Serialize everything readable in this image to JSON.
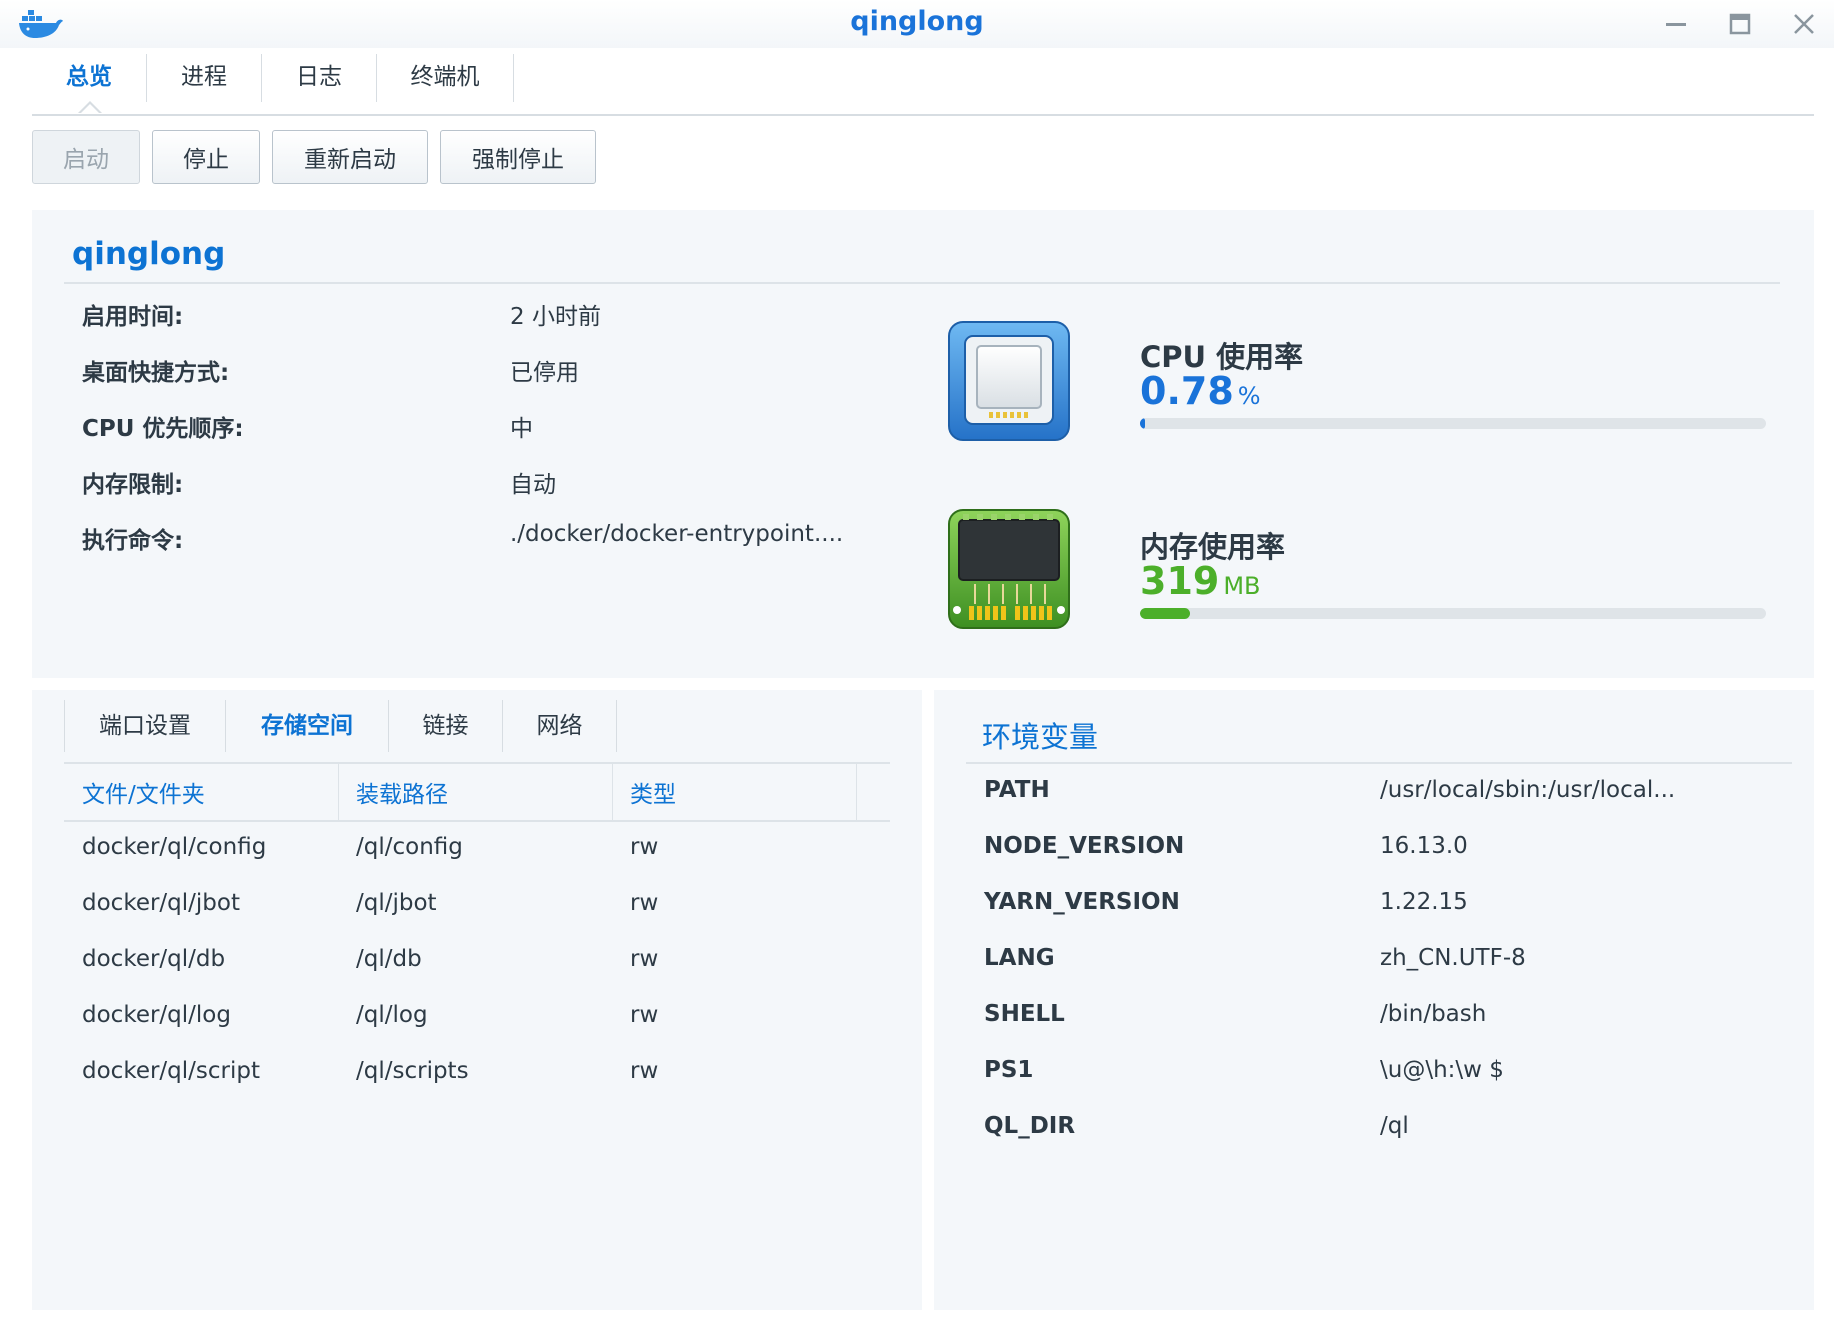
{
  "window": {
    "title": "qinglong",
    "app_icon": "docker-whale-icon"
  },
  "tabs": [
    {
      "label": "总览",
      "active": true
    },
    {
      "label": "进程",
      "active": false
    },
    {
      "label": "日志",
      "active": false
    },
    {
      "label": "终端机",
      "active": false
    }
  ],
  "toolbar": {
    "start": "启动",
    "stop": "停止",
    "restart": "重新启动",
    "force_stop": "强制停止"
  },
  "container": {
    "name": "qinglong",
    "info": [
      {
        "label": "启用时间:",
        "value": "2 小时前"
      },
      {
        "label": "桌面快捷方式:",
        "value": "已停用"
      },
      {
        "label": "CPU 优先顺序:",
        "value": "中"
      },
      {
        "label": "内存限制:",
        "value": "自动"
      },
      {
        "label": "执行命令:",
        "value": "./docker/docker-entrypoint...."
      }
    ],
    "cpu": {
      "title": "CPU 使用率",
      "value": "0.78",
      "unit": "%",
      "fraction": 0.0078,
      "color": "#1a73d9",
      "icon": "cpu-chip-icon"
    },
    "memory": {
      "title": "内存使用率",
      "value": "319",
      "unit": "MB",
      "fraction": 0.08,
      "color": "#4caf2a",
      "icon": "memory-module-icon"
    }
  },
  "subtabs": [
    {
      "label": "端口设置",
      "active": false
    },
    {
      "label": "存储空间",
      "active": true
    },
    {
      "label": "链接",
      "active": false
    },
    {
      "label": "网络",
      "active": false
    }
  ],
  "volumes": {
    "headers": [
      "文件/文件夹",
      "装载路径",
      "类型"
    ],
    "rows": [
      [
        "docker/ql/config",
        "/ql/config",
        "rw"
      ],
      [
        "docker/ql/jbot",
        "/ql/jbot",
        "rw"
      ],
      [
        "docker/ql/db",
        "/ql/db",
        "rw"
      ],
      [
        "docker/ql/log",
        "/ql/log",
        "rw"
      ],
      [
        "docker/ql/script",
        "/ql/scripts",
        "rw"
      ]
    ]
  },
  "env": {
    "title": "环境变量",
    "rows": [
      [
        "PATH",
        "/usr/local/sbin:/usr/local..."
      ],
      [
        "NODE_VERSION",
        "16.13.0"
      ],
      [
        "YARN_VERSION",
        "1.22.15"
      ],
      [
        "LANG",
        "zh_CN.UTF-8"
      ],
      [
        "SHELL",
        "/bin/bash"
      ],
      [
        "PS1",
        "\\u@\\h:\\w $"
      ],
      [
        "QL_DIR",
        "/ql"
      ]
    ]
  }
}
